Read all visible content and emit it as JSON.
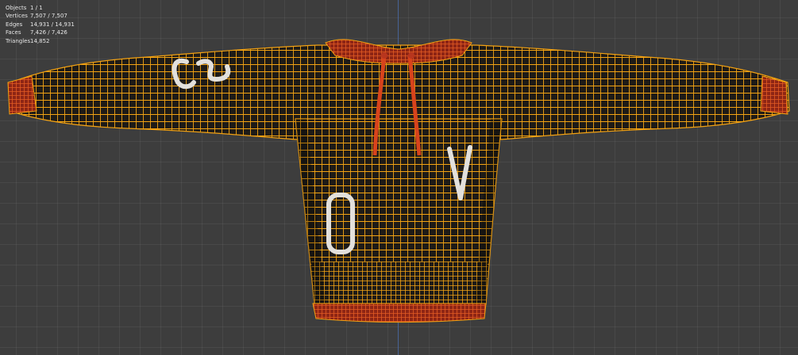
{
  "overlay": {
    "stats": [
      {
        "label": "Objects",
        "value": "1 / 1"
      },
      {
        "label": "Vertices",
        "value": "7,507 / 7,507"
      },
      {
        "label": "Edges",
        "value": "14,931 / 14,931"
      },
      {
        "label": "Faces",
        "value": "7,426 / 7,426"
      },
      {
        "label": "Triangles",
        "value": "14,852"
      }
    ]
  },
  "colors": {
    "background": "#3d3d3d",
    "wire": "#f2a112",
    "fabric": "#1c1a17",
    "cuff": "#b8361e",
    "axis": "#4a6aa6",
    "letters": "#e2e0dc"
  }
}
